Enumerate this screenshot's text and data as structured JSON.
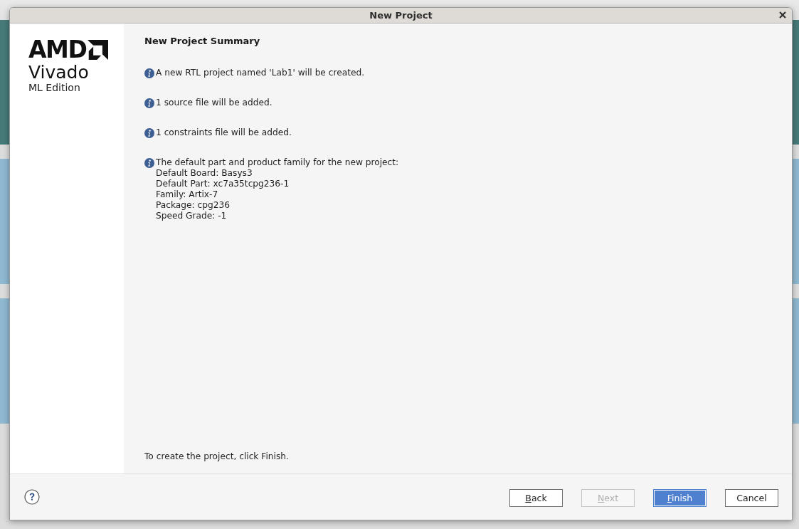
{
  "window": {
    "title": "New Project"
  },
  "sidebar": {
    "brand": "AMD",
    "product": "Vivado",
    "edition": "ML Edition"
  },
  "page": {
    "heading": "New Project Summary",
    "messages": [
      {
        "text": "A new RTL project named 'Lab1' will be created."
      },
      {
        "text": "1 source file will be added."
      },
      {
        "text": "1 constraints file will be added."
      },
      {
        "text": "The default part and product family for the new project:",
        "details": [
          "Default Board: Basys3",
          "Default Part: xc7a35tcpg236-1",
          "Family: Artix-7",
          "Package: cpg236",
          "Speed Grade: -1"
        ]
      }
    ],
    "footer_note": "To create the project, click Finish."
  },
  "buttons": [
    {
      "label": "Back",
      "mnemonic_underlined": true,
      "disabled": false,
      "default": false
    },
    {
      "label": "Next",
      "mnemonic_underlined": true,
      "disabled": true,
      "default": false
    },
    {
      "label": "Finish",
      "mnemonic_underlined": true,
      "disabled": false,
      "default": true
    },
    {
      "label": "Cancel",
      "mnemonic_underlined": false,
      "disabled": false,
      "default": false
    }
  ]
}
